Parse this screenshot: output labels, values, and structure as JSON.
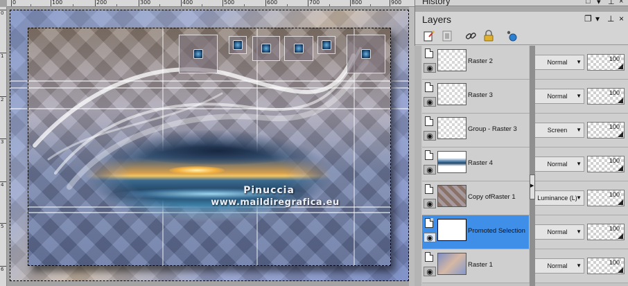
{
  "ruler": {
    "top_ticks": [
      "0",
      "100",
      "200",
      "300",
      "400",
      "500",
      "600",
      "700",
      "800",
      "900"
    ],
    "left_ticks": [
      "0",
      "1",
      "2",
      "3",
      "4",
      "5",
      "6"
    ]
  },
  "canvas": {
    "watermark_name": "Pinuccia",
    "watermark_url": "www.maildiregrafica.eu"
  },
  "panel": {
    "history_title": "History",
    "layers_title": "Layers"
  },
  "layers": [
    {
      "name": "Raster 2",
      "blend": "Normal",
      "opacity": "100",
      "thumb": "transparent",
      "selected": false
    },
    {
      "name": "Raster 3",
      "blend": "Normal",
      "opacity": "100",
      "thumb": "transparent",
      "selected": false
    },
    {
      "name": "Group - Raster 3",
      "blend": "Screen",
      "opacity": "100",
      "thumb": "transparent",
      "selected": false
    },
    {
      "name": "Raster 4",
      "blend": "Normal",
      "opacity": "100",
      "thumb": "seascape",
      "selected": false
    },
    {
      "name": "Copy ofRaster 1",
      "blend": "Luminance (L)",
      "opacity": "100",
      "thumb": "pattern",
      "selected": false
    },
    {
      "name": "Promoted Selection",
      "blend": "Normal",
      "opacity": "100",
      "thumb": "white",
      "selected": true
    },
    {
      "name": "Raster 1",
      "blend": "Normal",
      "opacity": "100",
      "thumb": "gradient",
      "selected": false
    }
  ],
  "colors": {
    "selection_highlight": "#3f8ee8",
    "panel_bg": "#c8c8c8"
  },
  "icons": {
    "toolbar": [
      "new-raster-layer-icon",
      "new-mask-layer-icon",
      "link-icon",
      "lock-icon",
      "layer-properties-icon"
    ]
  }
}
